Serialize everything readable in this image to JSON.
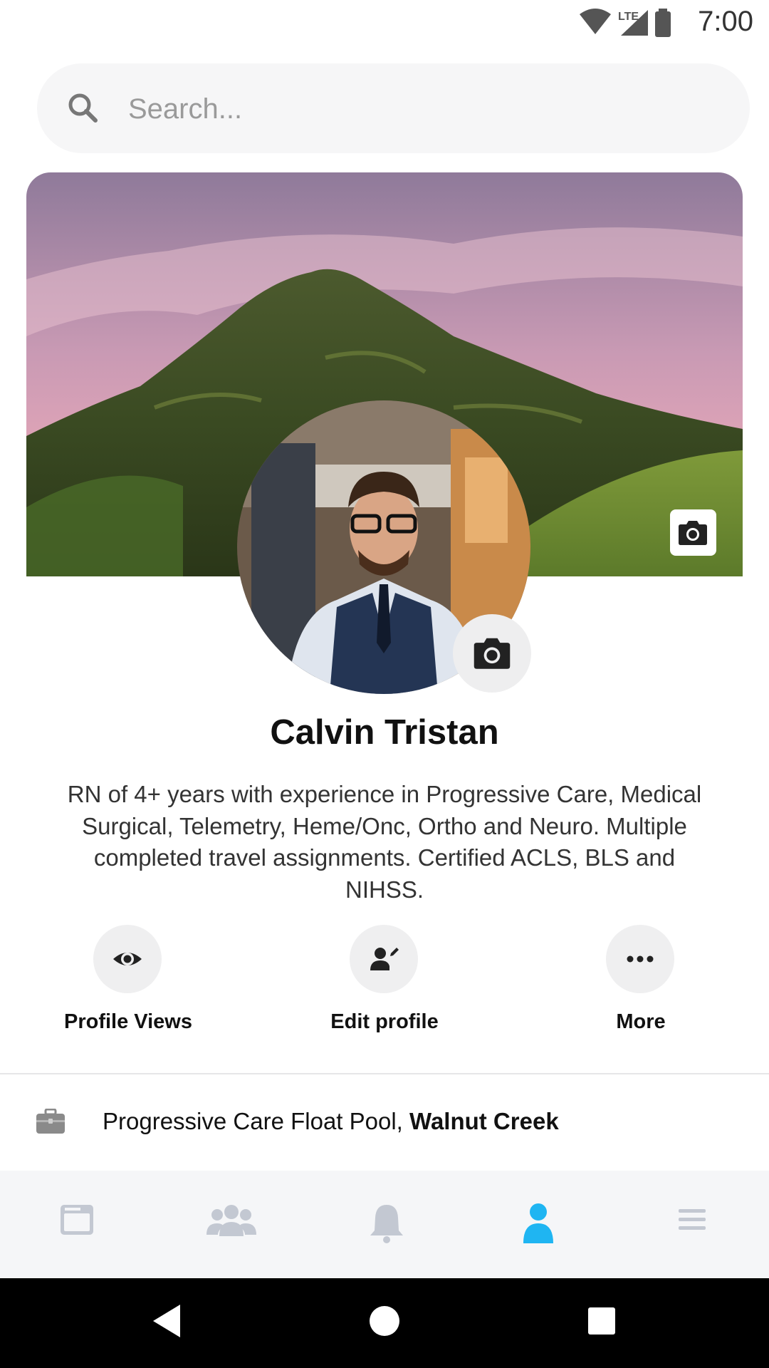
{
  "status": {
    "time": "7:00",
    "network": "LTE"
  },
  "search": {
    "placeholder": "Search..."
  },
  "profile": {
    "name": "Calvin Tristan",
    "bio": "RN of 4+ years with experience in Progressive Care, Medical Surgical, Telemetry, Heme/Onc, Ortho and Neuro. Multiple completed travel assignments. Certified ACLS, BLS and NIHSS."
  },
  "actions": [
    {
      "label": "Profile Views",
      "icon": "eye-icon"
    },
    {
      "label": "Edit profile",
      "icon": "edit-person-icon"
    },
    {
      "label": "More",
      "icon": "more-dots-icon"
    }
  ],
  "work": {
    "role": "Progressive Care Float Pool, ",
    "location": "Walnut Creek",
    "icon": "briefcase-icon"
  },
  "bottom_nav": [
    {
      "icon": "feed-icon",
      "active": false
    },
    {
      "icon": "groups-icon",
      "active": false
    },
    {
      "icon": "bell-icon",
      "active": false
    },
    {
      "icon": "profile-icon",
      "active": true
    },
    {
      "icon": "menu-icon",
      "active": false
    }
  ],
  "colors": {
    "accent": "#1fb5f2",
    "inactive_nav": "#c3c8d2",
    "icon_dark": "#222222"
  }
}
